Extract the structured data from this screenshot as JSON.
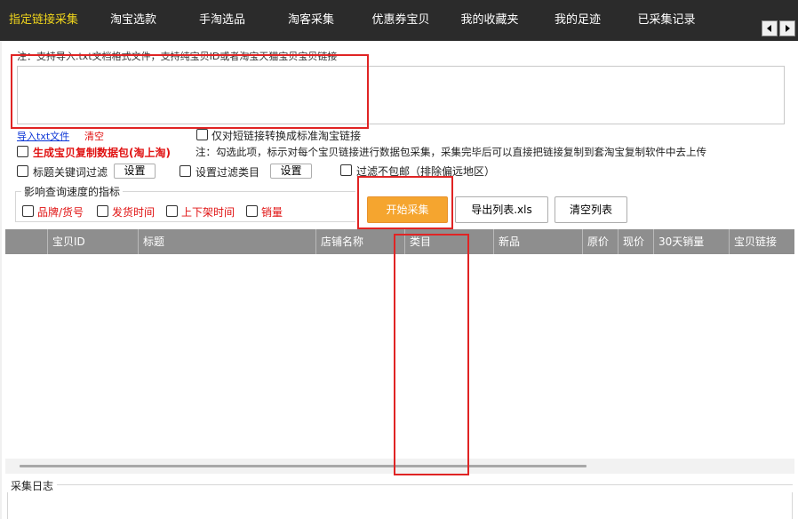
{
  "tabs": [
    {
      "label": "指定链接采集",
      "active": true
    },
    {
      "label": "淘宝选款",
      "active": false
    },
    {
      "label": "手淘选品",
      "active": false
    },
    {
      "label": "淘客采集",
      "active": false
    },
    {
      "label": "优惠券宝贝",
      "active": false
    },
    {
      "label": "我的收藏夹",
      "active": false
    },
    {
      "label": "我的足迹",
      "active": false
    },
    {
      "label": "已采集记录",
      "active": false
    }
  ],
  "note": "注：支持导入.txt文档格式文件，支持纯宝贝ID或者淘宝天猫宝贝宝贝链接",
  "url_input": {
    "value": "",
    "placeholder": ""
  },
  "links": {
    "import_txt": "导入txt文件",
    "clear": "清空"
  },
  "options": {
    "convert_short_link": "仅对短链接转换成标准淘宝链接",
    "generate_copy_package": "生成宝贝复制数据包(淘上淘)",
    "copy_package_note": "注：勾选此项，标示对每个宝贝链接进行数据包采集，采集完毕后可以直接把链接复制到套淘宝复制软件中去上传",
    "title_keyword_filter": "标题关键词过滤",
    "set_filter_category": "设置过滤类目",
    "filter_no_free_shipping": "过滤不包邮（排除偏远地区）",
    "settings_button": "设置",
    "settings_button2": "设置"
  },
  "speed_group": {
    "title": "影响查询速度的指标",
    "items": [
      "品牌/货号",
      "发货时间",
      "上下架时间",
      "销量"
    ]
  },
  "buttons": {
    "start": "开始采集",
    "export": "导出列表.xls",
    "clear_list": "清空列表"
  },
  "table": {
    "columns": [
      "宝贝ID",
      "标题",
      "店铺名称",
      "类目",
      "新品",
      "原价",
      "现价",
      "30天销量",
      "宝贝链接"
    ],
    "rows": []
  },
  "log": {
    "title": "采集日志"
  },
  "colors": {
    "tabbar": "#2b2b2b",
    "active_tab": "#f0d51c",
    "accent_orange": "#f5a52f",
    "highlight_red": "#e02424",
    "table_header": "#8e8e8e"
  }
}
